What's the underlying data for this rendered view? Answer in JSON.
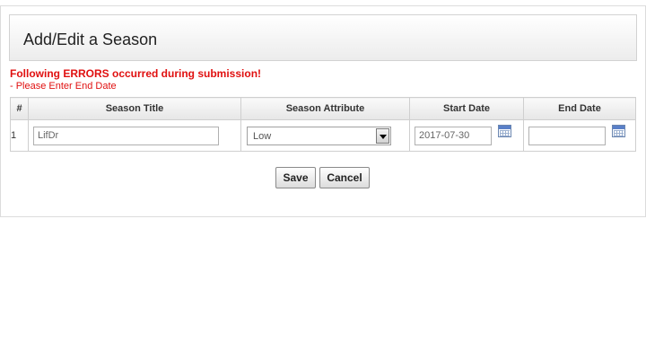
{
  "header": {
    "title": "Add/Edit a Season"
  },
  "errors": {
    "title": "Following ERRORS occurred during submission!",
    "items": [
      "- Please Enter End Date"
    ]
  },
  "table": {
    "columns": [
      "#",
      "Season Title",
      "Season Attribute",
      "Start Date",
      "End Date"
    ],
    "rows": [
      {
        "num": "1",
        "season_title": "LifDr",
        "season_attribute": "Low",
        "start_date": "2017-07-30",
        "end_date": ""
      }
    ]
  },
  "icons": {
    "calendar": "calendar-icon",
    "dropdown": "chevron-down-icon"
  },
  "buttons": {
    "save": "Save",
    "cancel": "Cancel"
  },
  "colors": {
    "error": "#e01010"
  }
}
